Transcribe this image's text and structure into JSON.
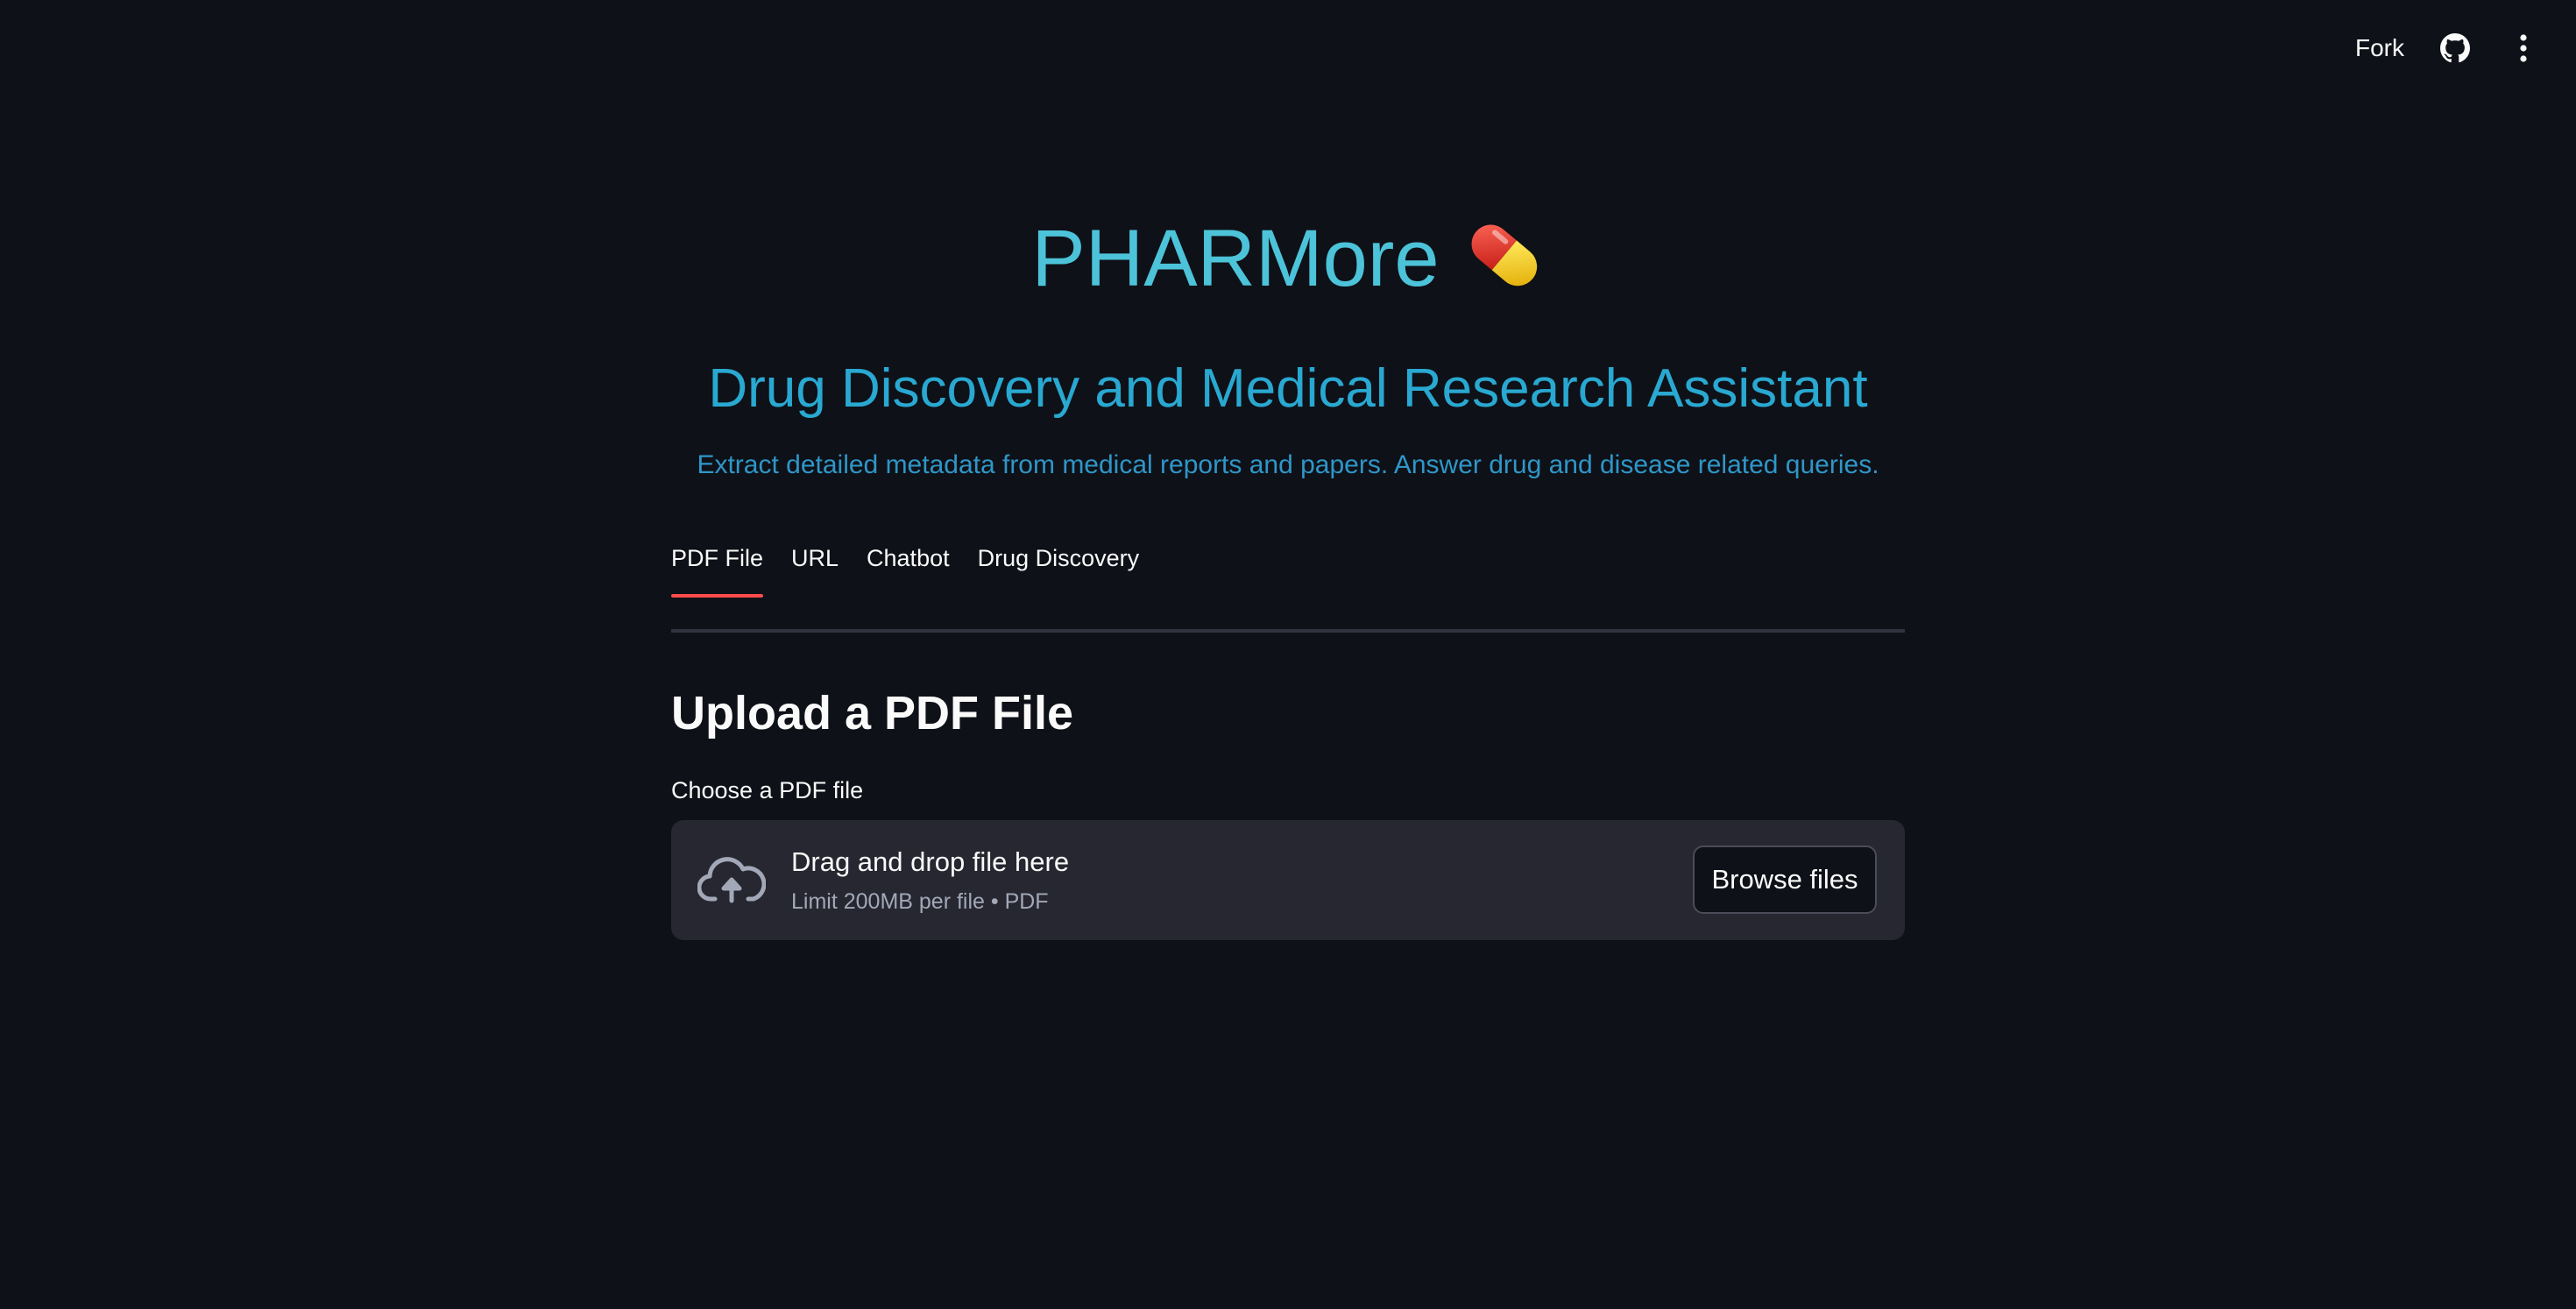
{
  "toolbar": {
    "fork_label": "Fork",
    "github_icon": "github-icon",
    "menu_icon": "vertical-ellipsis-icon"
  },
  "header": {
    "title": "PHARMore",
    "title_icon": "pill-icon",
    "subtitle": "Drug Discovery and Medical Research Assistant",
    "description": "Extract detailed metadata from medical reports and papers. Answer drug and disease related queries."
  },
  "tabs": [
    {
      "label": "PDF File",
      "active": true
    },
    {
      "label": "URL",
      "active": false
    },
    {
      "label": "Chatbot",
      "active": false
    },
    {
      "label": "Drug Discovery",
      "active": false
    }
  ],
  "upload": {
    "heading": "Upload a PDF File",
    "field_label": "Choose a PDF file",
    "dropzone_title": "Drag and drop file here",
    "dropzone_limit": "Limit 200MB per file • PDF",
    "browse_label": "Browse files",
    "icon": "cloud-upload-icon"
  },
  "colors": {
    "background": "#0e1117",
    "title": "#4cc3d9",
    "subtitle": "#29a8d1",
    "description": "#2f96c8",
    "tab_active_underline": "#ff4b4b",
    "dropzone_bg": "#262730"
  }
}
